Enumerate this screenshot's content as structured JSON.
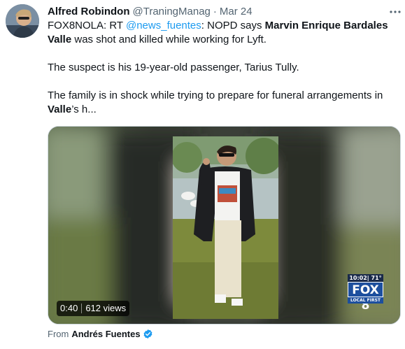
{
  "tweet": {
    "display_name": "Alfred Robindon",
    "handle": "@TraningManag",
    "separator": "·",
    "date": "Mar 24",
    "more_icon": "more-horizontal-icon",
    "body": {
      "line1_prefix": "FOX8NOLA: RT ",
      "mention": "@news_fuentes",
      "line1_middle": ": NOPD says ",
      "bold_name": "Marvin Enrique Bardales Valle",
      "line1_suffix": " was shot and killed while working for Lyft.",
      "paragraph2": "The suspect is his 19-year-old passenger, Tarius Tully.",
      "paragraph3_prefix": "The family is in shock while trying to prepare for funeral arrangements in ",
      "paragraph3_bold": "Valle",
      "paragraph3_suffix": "’s h..."
    },
    "video": {
      "duration": "0:40",
      "views": "612 views",
      "station_time": "10:02| 71°",
      "station_logo": "FOX 8",
      "station_sub": "LOCAL FIRST"
    },
    "attribution": {
      "label": "From",
      "author": "Andrés Fuentes",
      "verified_icon": "verified-badge-icon"
    }
  },
  "colors": {
    "link": "#1d9bf0",
    "secondary_text": "#536471",
    "primary_text": "#0f1419",
    "verified": "#1d9bf0"
  }
}
